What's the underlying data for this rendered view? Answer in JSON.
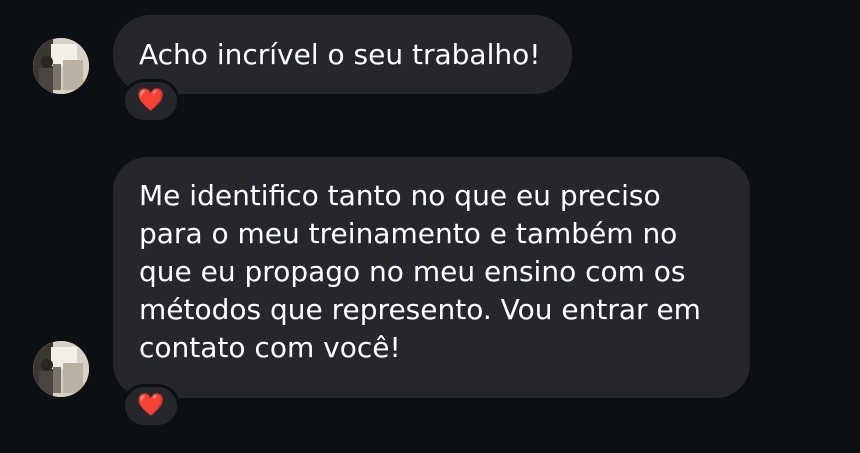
{
  "messages": [
    {
      "text": "Acho incrível o seu trabalho!",
      "reaction": "❤️",
      "reaction_icon": "heart-icon"
    },
    {
      "text": "Me identifico tanto no que eu preciso para o meu treinamento e também no que eu propago no meu ensino com os métodos que represento. Vou entrar em contato com você!",
      "reaction": "❤️",
      "reaction_icon": "heart-icon"
    }
  ],
  "colors": {
    "background": "#0c0f14",
    "bubble": "#25272c",
    "text": "#ffffff",
    "heart": "#e8354a"
  }
}
